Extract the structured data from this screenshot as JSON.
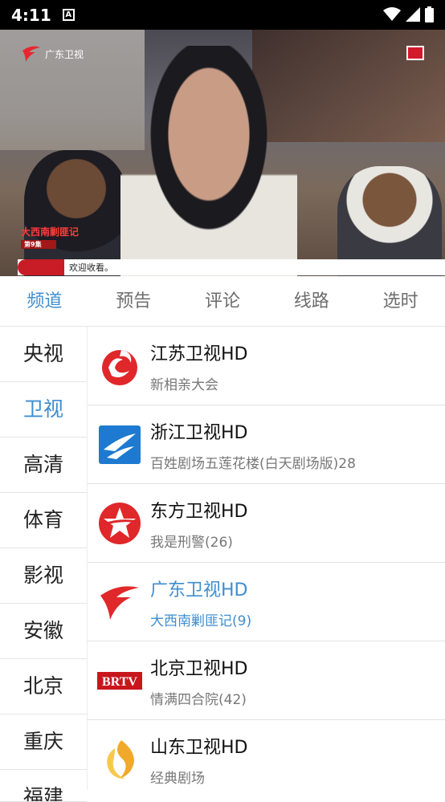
{
  "status": {
    "time": "4:11",
    "notif": "A"
  },
  "video": {
    "logo_text": "广东卫视",
    "show_title": "大西南剿匪记",
    "episode": "第9集",
    "ticker": "欢迎收看。"
  },
  "tabs": [
    {
      "label": "频道",
      "active": true
    },
    {
      "label": "预告",
      "active": false
    },
    {
      "label": "评论",
      "active": false
    },
    {
      "label": "线路",
      "active": false
    },
    {
      "label": "选时",
      "active": false
    }
  ],
  "categories": [
    {
      "label": "央视"
    },
    {
      "label": "卫视",
      "active": true
    },
    {
      "label": "高清"
    },
    {
      "label": "体育"
    },
    {
      "label": "影视"
    },
    {
      "label": "安徽"
    },
    {
      "label": "北京"
    },
    {
      "label": "重庆"
    },
    {
      "label": "福建"
    }
  ],
  "channels": [
    {
      "name": "江苏卫视HD",
      "program": "新相亲大会",
      "logo": "jiangsu-logo-icon"
    },
    {
      "name": "浙江卫视HD",
      "program": "百姓剧场五莲花楼(白天剧场版)28",
      "logo": "zhejiang-logo-icon"
    },
    {
      "name": "东方卫视HD",
      "program": "我是刑警(26)",
      "logo": "dongfang-logo-icon"
    },
    {
      "name": "广东卫视HD",
      "program": "大西南剿匪记(9)",
      "logo": "guangdong-logo-icon",
      "active": true
    },
    {
      "name": "北京卫视HD",
      "program": "情满四合院(42)",
      "logo": "brtv-logo-icon"
    },
    {
      "name": "山东卫视HD",
      "program": "经典剧场",
      "logo": "shandong-logo-icon"
    }
  ],
  "brtv_text": "BRTV",
  "colors": {
    "accent": "#3e8ed0"
  }
}
